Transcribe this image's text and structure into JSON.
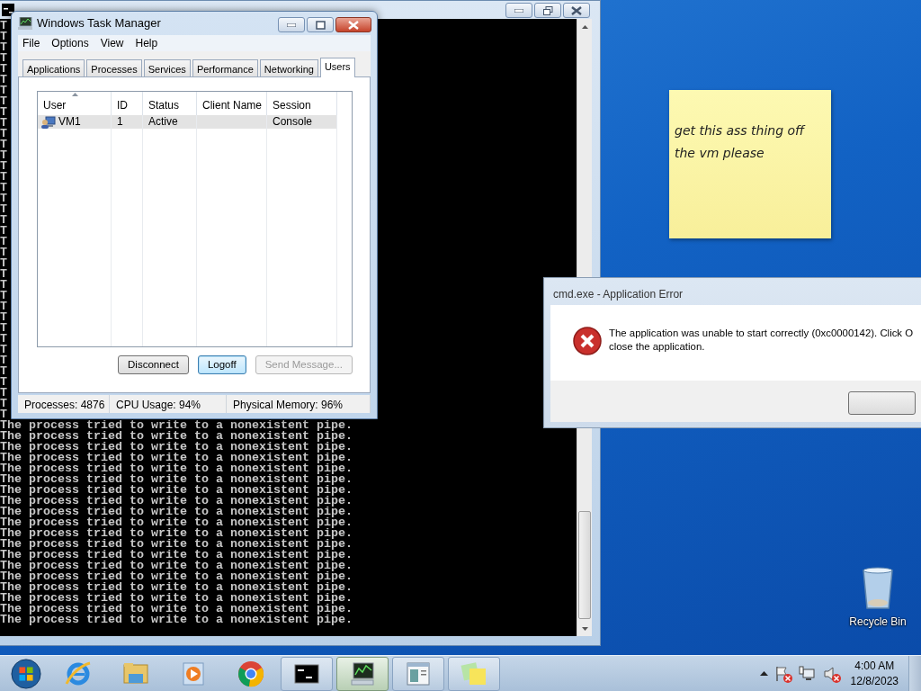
{
  "command_prompt": {
    "clipped_lines": [
      "T",
      "T",
      "T",
      "T",
      "T",
      "T",
      "T",
      "T",
      "T",
      "T",
      "T",
      "T",
      "T",
      "T",
      "T",
      "T",
      "T",
      "T",
      "T",
      "T",
      "T",
      "T",
      "T",
      "T",
      "T",
      "T",
      "T",
      "T",
      "T",
      "T",
      "T",
      "T",
      "T",
      "T",
      "T",
      "T",
      "T"
    ],
    "lines": [
      "The process tried to write to a nonexistent pipe.",
      "The process tried to write to a nonexistent pipe.",
      "The process tried to write to a nonexistent pipe.",
      "The process tried to write to a nonexistent pipe.",
      "The process tried to write to a nonexistent pipe.",
      "The process tried to write to a nonexistent pipe.",
      "The process tried to write to a nonexistent pipe.",
      "The process tried to write to a nonexistent pipe.",
      "The process tried to write to a nonexistent pipe.",
      "The process tried to write to a nonexistent pipe.",
      "The process tried to write to a nonexistent pipe.",
      "The process tried to write to a nonexistent pipe.",
      "The process tried to write to a nonexistent pipe.",
      "The process tried to write to a nonexistent pipe.",
      "The process tried to write to a nonexistent pipe.",
      "The process tried to write to a nonexistent pipe.",
      "The process tried to write to a nonexistent pipe.",
      "The process tried to write to a nonexistent pipe.",
      "The process tried to write to a nonexistent pipe."
    ]
  },
  "task_manager": {
    "title": "Windows Task Manager",
    "menu": [
      "File",
      "Options",
      "View",
      "Help"
    ],
    "tabs": [
      {
        "label": "Applications",
        "selected": false
      },
      {
        "label": "Processes",
        "selected": false
      },
      {
        "label": "Services",
        "selected": false
      },
      {
        "label": "Performance",
        "selected": false
      },
      {
        "label": "Networking",
        "selected": false
      },
      {
        "label": "Users",
        "selected": true
      }
    ],
    "columns": [
      {
        "label": "User",
        "sorted": true
      },
      {
        "label": "ID",
        "sorted": false
      },
      {
        "label": "Status",
        "sorted": false
      },
      {
        "label": "Client Name",
        "sorted": false
      },
      {
        "label": "Session",
        "sorted": false
      }
    ],
    "rows": [
      {
        "user": "VM1",
        "id": "1",
        "status": "Active",
        "client_name": "",
        "session": "Console",
        "selected": true
      }
    ],
    "buttons": [
      {
        "label": "Disconnect",
        "disabled": false,
        "focused": false
      },
      {
        "label": "Logoff",
        "disabled": false,
        "focused": true
      },
      {
        "label": "Send Message...",
        "disabled": true,
        "focused": false
      }
    ],
    "status_bar": [
      "Processes: 4876",
      "CPU Usage: 94%",
      "Physical Memory: 96%"
    ]
  },
  "sticky_note": {
    "text": "get this ass thing off the vm please"
  },
  "error_dialog": {
    "title": "cmd.exe - Application Error",
    "message_lines": [
      "The application was unable to start correctly (0xc0000142). Click O",
      "close the application."
    ]
  },
  "desktop_icons": [
    {
      "label": "Recycle Bin"
    }
  ],
  "taskbar": {
    "items": [
      {
        "kind": "ie",
        "running": false,
        "active": false
      },
      {
        "kind": "folder",
        "running": false,
        "active": false
      },
      {
        "kind": "media",
        "running": false,
        "active": false
      },
      {
        "kind": "chrome",
        "running": false,
        "active": false
      },
      {
        "kind": "cmd",
        "running": true,
        "active": false
      },
      {
        "kind": "taskmgr",
        "running": true,
        "active": true
      },
      {
        "kind": "window",
        "running": true,
        "active": false
      },
      {
        "kind": "notes",
        "running": true,
        "active": false
      }
    ],
    "tray": [
      {
        "kind": "flag",
        "alert": true
      },
      {
        "kind": "network",
        "alert": false
      },
      {
        "kind": "speaker",
        "alert": true
      }
    ],
    "clock": {
      "time": "4:00 AM",
      "date": "12/8/2023"
    }
  }
}
